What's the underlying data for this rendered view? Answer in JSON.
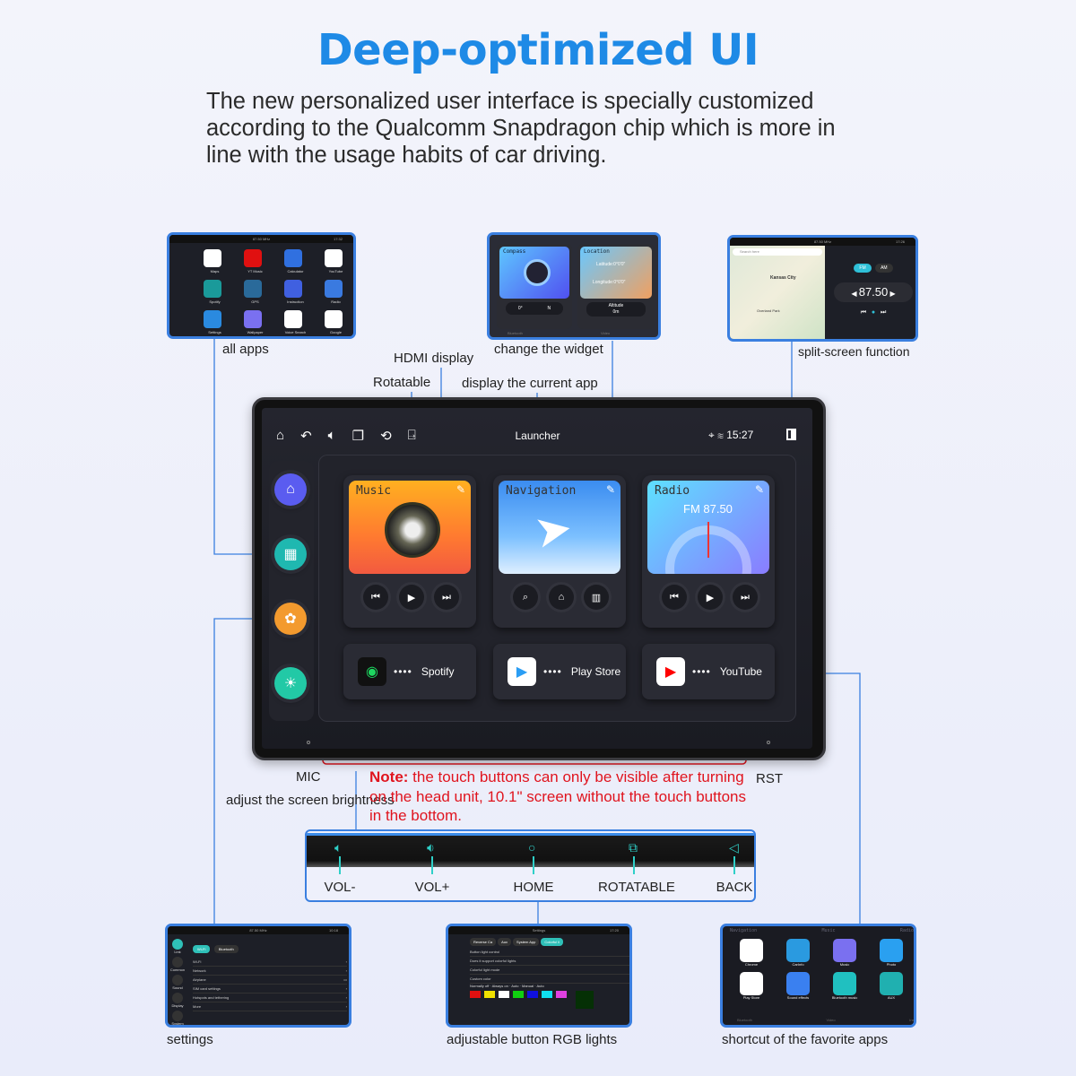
{
  "header": {
    "title": "Deep-optimized UI",
    "intro": "The new personalized user interface is specially customized according to the Qualcomm Snapdragon chip which is more in line with the usage habits of car driving."
  },
  "colors": {
    "accent": "#1e8ae6",
    "line": "#3a7fe0",
    "note": "#e0141e",
    "teal": "#2fd0c8"
  },
  "callouts": {
    "all_apps": "all apps",
    "change_widget": "change the widget",
    "split_screen": "split-screen function",
    "hdmi": "HDMI display",
    "rotatable": "Rotatable",
    "current_app": "display the current app",
    "mic": "MIC",
    "brightness": "adjust the screen brightness",
    "rst": "RST",
    "settings": "settings",
    "rgb": "adjustable button RGB lights",
    "favorites": "shortcut of the favorite apps"
  },
  "thumb_all_apps": {
    "status": "87.50 MHz",
    "time": "17:32",
    "apps": [
      "Maps",
      "YT Music",
      "Calculator",
      "YouTube",
      "Spotify",
      "GPS",
      "Instruction",
      "Radio",
      "Settings",
      "Wallpaper",
      "Voice Search",
      "Google"
    ]
  },
  "thumb_widget": {
    "compass": "Compass",
    "compass_deg": "0°",
    "compass_dir": "N",
    "location": "Location",
    "latitude": "Latitude:0°0'0\"",
    "longitude": "Longitude:0°0'0\"",
    "altitude": "Altitude",
    "altitude_val": "0m",
    "bottom_left": "Bluetooth",
    "bottom_right": "Video"
  },
  "thumb_split": {
    "status": "87.50 MHz",
    "time": "17:26",
    "search": "Search here",
    "city": "Kansas City",
    "suburb": "Overland Park",
    "fm": "FM",
    "am": "AM",
    "freq": "87.50",
    "unit": "MHz"
  },
  "head_unit": {
    "status_center": "Launcher",
    "time": "15:27",
    "cards": [
      {
        "title": "Music"
      },
      {
        "title": "Navigation"
      },
      {
        "title": "Radio",
        "sub": "FM 87.50"
      }
    ],
    "tiles": [
      {
        "label": "Spotify"
      },
      {
        "label": "Play Store"
      },
      {
        "label": "YouTube"
      }
    ],
    "icons": [
      "home-icon",
      "back-icon",
      "volume-icon",
      "recents-icon",
      "rotate-icon",
      "hdmi-icon"
    ]
  },
  "note": {
    "bold": "Note:",
    "text": " the touch buttons can only be visible after turning on the head unit, 10.1\" screen without the touch buttons in the bottom."
  },
  "touch_buttons": [
    {
      "label": "VOL-",
      "icon": "volume-down-icon"
    },
    {
      "label": "VOL+",
      "icon": "volume-up-icon"
    },
    {
      "label": "HOME",
      "icon": "home-circle-icon"
    },
    {
      "label": "ROTATABLE",
      "icon": "rotate-icon"
    },
    {
      "label": "BACK",
      "icon": "back-triangle-icon"
    }
  ],
  "thumb_settings": {
    "status": "87.50 MHz",
    "time": "10:18",
    "tabs": [
      "Wi-Fi",
      "Bluetooth"
    ],
    "rows": [
      "Wi-Fi",
      "Network",
      "Airplane",
      "SIM card settings",
      "Hotspots and tethering",
      "More"
    ],
    "side": [
      "Link",
      "Common",
      "Sound",
      "Display",
      "System"
    ]
  },
  "thumb_rgb": {
    "title": "Settings",
    "time": "17:20",
    "tabs": [
      "Reverse Ca",
      "Aux",
      "System App",
      "Colorful li"
    ],
    "rows": [
      "Button light control",
      "Does it support colorful lights",
      "Colorful light mode",
      "Custom color"
    ],
    "options": [
      "Normally off",
      "Always on",
      "Auto",
      "Manual",
      "Auto"
    ],
    "swatches": [
      "#e01010",
      "#f0e000",
      "#ffffff",
      "#10d010",
      "#1010e0",
      "#10e0f0",
      "#e040e0"
    ]
  },
  "thumb_fav": {
    "apps": [
      "Chrome",
      "CarInfo",
      "Music",
      "Photo",
      "Play Store",
      "Sound effects",
      "Bluetooth music",
      "AUX"
    ],
    "bg_cards": [
      "Navigation",
      "Music",
      "Radio"
    ],
    "bg_tiles": [
      "Bluetooth",
      "Video",
      "Instr"
    ]
  }
}
